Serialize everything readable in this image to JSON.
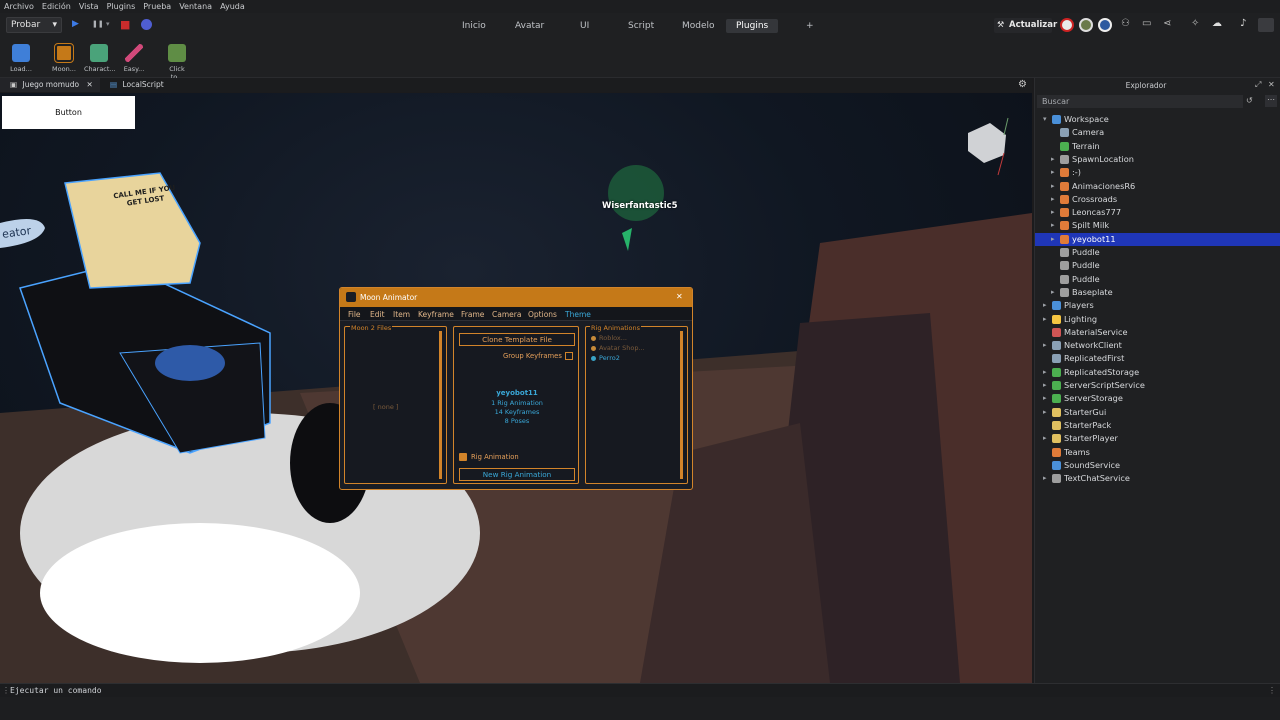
{
  "menubar": [
    "Archivo",
    "Edición",
    "Vista",
    "Plugins",
    "Prueba",
    "Ventana",
    "Ayuda"
  ],
  "probar": {
    "label": "Probar",
    "chevron": "▾"
  },
  "play_controls": {
    "play": "▶",
    "pause": "❚❚",
    "stop": "■",
    "chevron": "▾"
  },
  "top_tabs": [
    "Inicio",
    "Avatar",
    "UI",
    "Script",
    "Modelo",
    "Plugins",
    "+"
  ],
  "active_tab": "Plugins",
  "update_button": "Actualizar",
  "tools": [
    {
      "label": "Load...",
      "color": "#3f7fd8"
    },
    {
      "label": "Moon...",
      "color": "#c57918"
    },
    {
      "label": "Charact...",
      "color": "#4aa37a"
    },
    {
      "label": "Easy...",
      "color": "#d1497a"
    },
    {
      "label": "Click to...",
      "color": "#5f8d45"
    }
  ],
  "doc_tabs": [
    {
      "label": "Juego momudo",
      "close": "✕"
    },
    {
      "label": "LocalScript",
      "close": "✕"
    }
  ],
  "viewport": {
    "button_label": "Button",
    "player_name": "Wiserfantastic5",
    "hat_text": "CALL ME IF YOU GET LOST",
    "creator_partial": "eator"
  },
  "moon": {
    "title": "Moon Animator",
    "close": "✕",
    "menu": [
      "File",
      "Edit",
      "Item",
      "Keyframe",
      "Frame",
      "Camera",
      "Options",
      "Theme"
    ],
    "files_label": "Moon 2 Files",
    "none_text": "[ none ]",
    "clone_btn": "Clone Template File",
    "group_keyframes": "Group Keyframes",
    "rig_name": "yeyobot11",
    "rig_info": [
      "1 Rig Animation",
      "14 Keyframes",
      "8 Poses"
    ],
    "rig_animation_label": "Rig Animation",
    "new_rig_btn": "New Rig Animation",
    "rig_anims_label": "Rig Animations",
    "rig_anims": [
      {
        "label": "Roblox...",
        "color": "#c58a3a"
      },
      {
        "label": "Avatar Shop...",
        "color": "#c58a3a"
      },
      {
        "label": "Perro2",
        "color": "#3aa3c5"
      }
    ]
  },
  "explorer": {
    "title": "Explorador",
    "search_placeholder": "Buscar",
    "items": [
      {
        "label": "Workspace",
        "depth": 0,
        "arrow": "▾",
        "icon": "#4a90d9"
      },
      {
        "label": "Camera",
        "depth": 1,
        "arrow": "",
        "icon": "#8aa0b5"
      },
      {
        "label": "Terrain",
        "depth": 1,
        "arrow": "",
        "icon": "#4caf50"
      },
      {
        "label": "SpawnLocation",
        "depth": 1,
        "arrow": "▸",
        "icon": "#9e9e9e"
      },
      {
        "label": ":-)",
        "depth": 1,
        "arrow": "▸",
        "icon": "#e07b39"
      },
      {
        "label": "AnimacionesR6",
        "depth": 1,
        "arrow": "▸",
        "icon": "#e07b39"
      },
      {
        "label": "Crossroads",
        "depth": 1,
        "arrow": "▸",
        "icon": "#e07b39"
      },
      {
        "label": "Leoncas777",
        "depth": 1,
        "arrow": "▸",
        "icon": "#e07b39"
      },
      {
        "label": "Spilt Milk",
        "depth": 1,
        "arrow": "▸",
        "icon": "#e07b39"
      },
      {
        "label": "yeyobot11",
        "depth": 1,
        "arrow": "▸",
        "icon": "#e07b39",
        "selected": true
      },
      {
        "label": "Puddle",
        "depth": 1,
        "arrow": "",
        "icon": "#9e9e9e"
      },
      {
        "label": "Puddle",
        "depth": 1,
        "arrow": "",
        "icon": "#9e9e9e"
      },
      {
        "label": "Puddle",
        "depth": 1,
        "arrow": "",
        "icon": "#9e9e9e"
      },
      {
        "label": "Baseplate",
        "depth": 1,
        "arrow": "▸",
        "icon": "#9e9e9e"
      },
      {
        "label": "Players",
        "depth": 0,
        "arrow": "▸",
        "icon": "#4a90d9"
      },
      {
        "label": "Lighting",
        "depth": 0,
        "arrow": "▸",
        "icon": "#f5c542"
      },
      {
        "label": "MaterialService",
        "depth": 0,
        "arrow": "",
        "icon": "#d05555"
      },
      {
        "label": "NetworkClient",
        "depth": 0,
        "arrow": "▸",
        "icon": "#8aa0b5"
      },
      {
        "label": "ReplicatedFirst",
        "depth": 0,
        "arrow": "",
        "icon": "#8aa0b5"
      },
      {
        "label": "ReplicatedStorage",
        "depth": 0,
        "arrow": "▸",
        "icon": "#4caf50"
      },
      {
        "label": "ServerScriptService",
        "depth": 0,
        "arrow": "▸",
        "icon": "#4caf50"
      },
      {
        "label": "ServerStorage",
        "depth": 0,
        "arrow": "▸",
        "icon": "#4caf50"
      },
      {
        "label": "StarterGui",
        "depth": 0,
        "arrow": "▸",
        "icon": "#e0c060"
      },
      {
        "label": "StarterPack",
        "depth": 0,
        "arrow": "",
        "icon": "#e0c060"
      },
      {
        "label": "StarterPlayer",
        "depth": 0,
        "arrow": "▸",
        "icon": "#e0c060"
      },
      {
        "label": "Teams",
        "depth": 0,
        "arrow": "",
        "icon": "#e07b39"
      },
      {
        "label": "SoundService",
        "depth": 0,
        "arrow": "",
        "icon": "#4a90d9"
      },
      {
        "label": "TextChatService",
        "depth": 0,
        "arrow": "▸",
        "icon": "#9e9e9e"
      }
    ]
  },
  "command_bar": {
    "prompt": "⋮",
    "placeholder": "Ejecutar un comando"
  }
}
